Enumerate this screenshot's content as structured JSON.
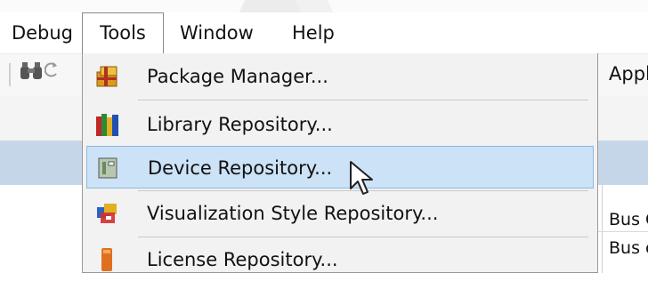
{
  "menubar": {
    "items": [
      {
        "label": "Debug"
      },
      {
        "label": "Tools"
      },
      {
        "label": "Window"
      },
      {
        "label": "Help"
      }
    ]
  },
  "toolbar": {
    "right_text": "Applic"
  },
  "tools_menu": {
    "items": [
      {
        "label": "Package Manager...",
        "icon": "package-icon"
      },
      {
        "label": "Library Repository...",
        "icon": "library-books-icon"
      },
      {
        "label": "Device Repository...",
        "icon": "device-icon",
        "highlighted": true
      },
      {
        "label": "Visualization Style Repository...",
        "icon": "visualization-style-icon"
      },
      {
        "label": "License Repository...",
        "icon": "license-icon"
      }
    ]
  },
  "background_pane": {
    "rows": [
      "Bus C",
      "Bus c"
    ]
  },
  "colors": {
    "highlight": "#cce2f6",
    "highlight_border": "#8fb8e0",
    "selected_row": "#c6d6e9",
    "menu_bg": "#f2f2f2"
  }
}
